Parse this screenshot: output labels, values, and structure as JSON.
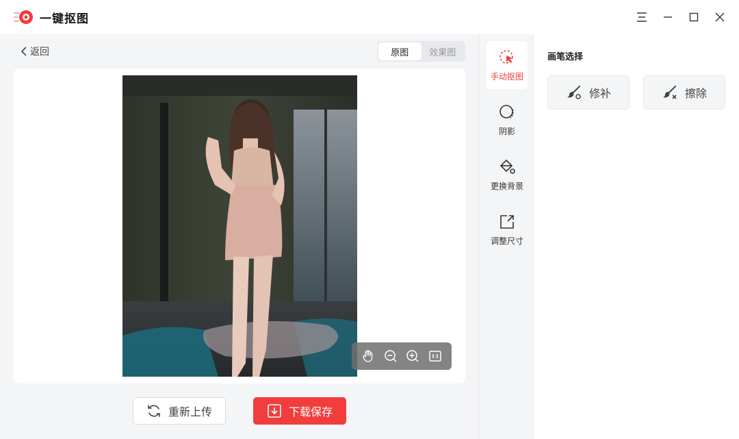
{
  "app": {
    "title": "一键抠图",
    "logo_icon": "logo-icon",
    "window_controls": [
      "menu-icon",
      "minimize-icon",
      "maximize-icon",
      "close-icon"
    ]
  },
  "nav": {
    "back_label": "返回"
  },
  "view_toggle": {
    "options": [
      "原图",
      "效果图"
    ],
    "selected": "原图"
  },
  "zoom_toolbar": {
    "icons": [
      "hand-icon",
      "zoom-out-icon",
      "zoom-in-icon",
      "fit-screen-icon"
    ]
  },
  "actions": {
    "reupload_label": "重新上传",
    "download_label": "下载保存"
  },
  "tools": [
    {
      "label": "手动抠图",
      "icon": "manual-cutout-icon",
      "active": true
    },
    {
      "label": "阴影",
      "icon": "shadow-icon",
      "active": false
    },
    {
      "label": "更换背景",
      "icon": "paint-bucket-icon",
      "active": false
    },
    {
      "label": "调整尺寸",
      "icon": "resize-icon",
      "active": false
    }
  ],
  "panel": {
    "title": "画笔选择",
    "brushes": [
      {
        "label": "修补",
        "icon": "repair-brush-icon"
      },
      {
        "label": "擦除",
        "icon": "erase-brush-icon"
      }
    ]
  },
  "colors": {
    "accent": "#f23d3d",
    "background": "#f4f5f7"
  }
}
